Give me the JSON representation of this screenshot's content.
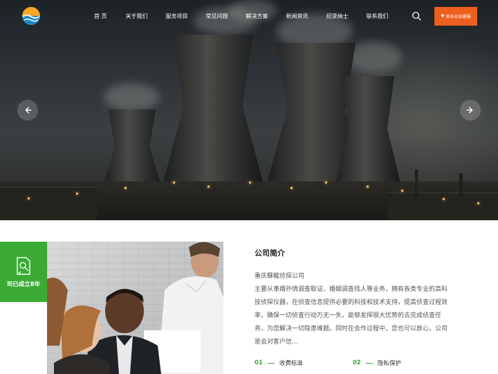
{
  "nav": {
    "items": [
      {
        "label": "首 页"
      },
      {
        "label": "关于我们"
      },
      {
        "label": "服务项目"
      },
      {
        "label": "常见问题"
      },
      {
        "label": "解决方案"
      },
      {
        "label": "新闻资讯"
      },
      {
        "label": "招贤纳士"
      },
      {
        "label": "联系我们"
      }
    ],
    "search_icon": "search-icon",
    "cta_label": "联系在线客服"
  },
  "hero": {
    "prev_icon": "arrow-left-icon",
    "next_icon": "arrow-right-icon"
  },
  "badge": {
    "text": "司已成立8年",
    "icon": "document-search-icon",
    "color": "#3aaa35"
  },
  "intro": {
    "title": "公司简介",
    "company": "重庆蘇龍侦探公司",
    "body": "主要从事婚外情调查取证、婚姻调查找人等业务，拥有各类专业的高科技侦探仪器，在侦查信息提供必要的科技和技术支持，提高侦查过程效率，确保一切侦查行动万无一失，能够发挥很大优势的去完成侦查任务，为您解决一切隐患难题。同时在合作过程中，您也可以放心，公司是会对客户信..."
  },
  "links": [
    {
      "num": "01",
      "label": "收费标准"
    },
    {
      "num": "02",
      "label": "隐私保护"
    }
  ],
  "colors": {
    "accent": "#ec5f1f",
    "green": "#3aaa35"
  }
}
